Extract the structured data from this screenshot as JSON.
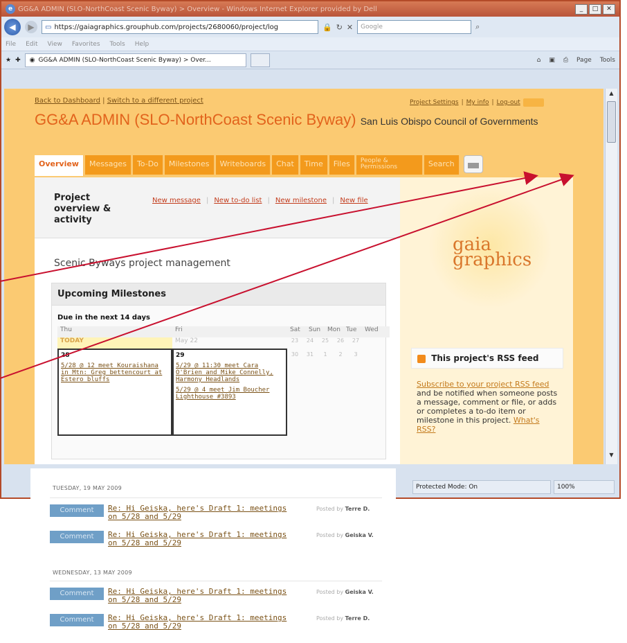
{
  "browser": {
    "title": "GG&A ADMIN (SLO-NorthCoast Scenic Byway) > Overview - Windows Internet Explorer provided by Dell",
    "url": "https://gaiagraphics.grouphub.com/projects/2680060/project/log",
    "search_placeholder": "Google",
    "menu": [
      "File",
      "Edit",
      "View",
      "Favorites",
      "Tools",
      "Help"
    ],
    "tab_label": "GG&A ADMIN (SLO-NorthCoast Scenic Byway) > Over...",
    "toolbar_right": [
      "Page",
      "Tools"
    ],
    "status": {
      "protected": "Protected Mode: On",
      "zoom": "100%"
    }
  },
  "header": {
    "back": "Back to Dashboard",
    "switch": "Switch to a different project",
    "separator": "|",
    "right_links": [
      "Project Settings",
      "My info",
      "Log-out"
    ],
    "project_title": "GG&A ADMIN (SLO-NorthCoast Scenic Byway)",
    "org": "San Luis Obispo Council of Governments"
  },
  "tabs": [
    "Overview",
    "Messages",
    "To-Do",
    "Milestones",
    "Writeboards",
    "Chat",
    "Time",
    "Files",
    "People & Permissions",
    "Search"
  ],
  "overview": {
    "title": "Project overview & activity",
    "links": [
      "New message",
      "New to-do list",
      "New milestone",
      "New file"
    ],
    "description": "Scenic Byways project management"
  },
  "milestones": {
    "header": "Upcoming Milestones",
    "due": "Due in the next 14 days",
    "days": [
      "Thu",
      "Fri",
      "Sat",
      "Sun",
      "Mon",
      "Tue",
      "Wed"
    ],
    "today": "TODAY",
    "fri_date": "May 22",
    "small_row1": [
      "23",
      "24",
      "25",
      "26",
      "27"
    ],
    "small_row2": [
      "30",
      "31",
      "1",
      "2",
      "3"
    ],
    "day28": {
      "num": "28",
      "items": [
        "5/28 @ 12 meet Kouraishana in Mtn: Greg bettencourt at Estero bluffs"
      ]
    },
    "day29": {
      "num": "29",
      "items": [
        "5/29 @ 11:30 meet Cara O'Brien and Mike Connelly, Harmony Headlands",
        "5/29 @ 4 meet Jim Boucher Lighthouse #3893"
      ]
    }
  },
  "feed": {
    "groups": [
      {
        "date": "TUESDAY, 19 MAY 2009",
        "items": [
          {
            "type": "Comment",
            "text": "Re: Hi Geiska, here's Draft 1: meetings on 5/28 and 5/29",
            "posted_by": "Posted by",
            "author": "Terre D."
          },
          {
            "type": "Comment",
            "text": "Re: Hi Geiska, here's Draft 1: meetings on 5/28 and 5/29",
            "posted_by": "Posted by",
            "author": "Geiska V."
          }
        ]
      },
      {
        "date": "WEDNESDAY, 13 MAY 2009",
        "items": [
          {
            "type": "Comment",
            "text": "Re: Hi Geiska, here's Draft 1: meetings on 5/28 and 5/29",
            "posted_by": "Posted by",
            "author": "Geiska V."
          },
          {
            "type": "Comment",
            "text": "Re: Hi Geiska, here's Draft 1: meetings on 5/28 and 5/29",
            "posted_by": "Posted by",
            "author": "Terre D."
          }
        ]
      }
    ]
  },
  "sidebar": {
    "logo_top": "gaia",
    "logo_bottom": "graphics",
    "rss_title": "This project's RSS feed",
    "rss_link": "Subscribe to your project RSS feed",
    "rss_body": " and be notified when someone posts a message, comment or file, or adds or completes a to-do item or milestone in this project. ",
    "rss_more": "What's RSS?"
  },
  "colors": {
    "accent": "#e2631c",
    "tab_orange": "#f39a1c",
    "arrow": "#c8102e",
    "comment_badge": "#6f9fc7"
  }
}
